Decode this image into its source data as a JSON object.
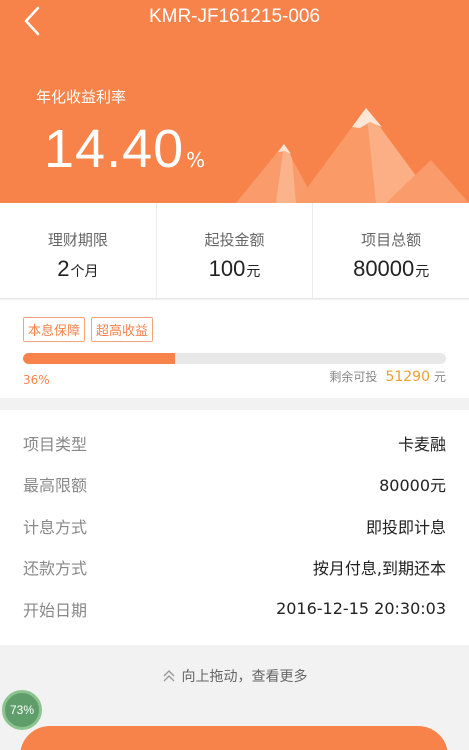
{
  "header": {
    "title": "KMR-JF161215-006"
  },
  "hero": {
    "rate_label": "年化收益利率",
    "rate_value": "14.40",
    "rate_unit": "%"
  },
  "stats": [
    {
      "label": "理财期限",
      "value": "2",
      "unit": "个月"
    },
    {
      "label": "起投金额",
      "value": "100",
      "unit": "元"
    },
    {
      "label": "项目总额",
      "value": "80000",
      "unit": "元"
    }
  ],
  "tags": [
    "本息保障",
    "超高收益"
  ],
  "progress": {
    "percent": 36,
    "percent_text": "36%",
    "remain_label": "剩余可投",
    "remain_amount": "51290",
    "remain_unit": "元"
  },
  "details": [
    {
      "label": "项目类型",
      "value": "卡麦融"
    },
    {
      "label": "最高限额",
      "value": "80000元"
    },
    {
      "label": "计息方式",
      "value": "即投即计息"
    },
    {
      "label": "还款方式",
      "value": "按月付息,到期还本"
    },
    {
      "label": "开始日期",
      "value": "2016-12-15 20:30:03"
    }
  ],
  "pull_hint": "向上拖动，查看更多",
  "badge": "73%",
  "colors": {
    "accent": "#f7834a",
    "remain_amount": "#f0a030"
  }
}
